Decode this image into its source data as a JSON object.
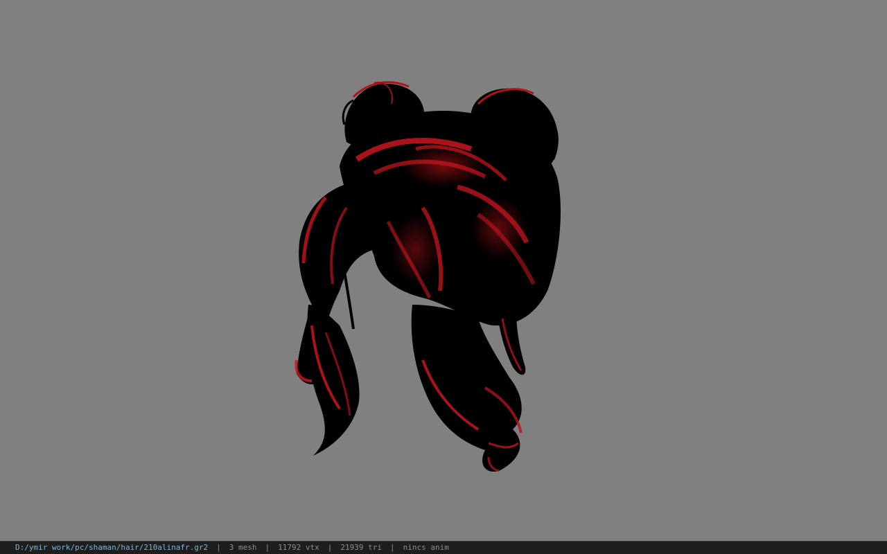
{
  "viewport": {
    "background_color": "#808080",
    "model_colors": {
      "base": "#000000",
      "highlight": "#c8161e",
      "highlight_dark": "#7a0c10"
    }
  },
  "status_bar": {
    "file_path": "D:/ymir work/pc/shaman/hair/210alinafr.gr2",
    "mesh_count": "3 mesh",
    "vertex_count": "11792 vtx",
    "triangle_count": "21939 tri",
    "anim_status": "nincs anim",
    "separator": "|"
  }
}
